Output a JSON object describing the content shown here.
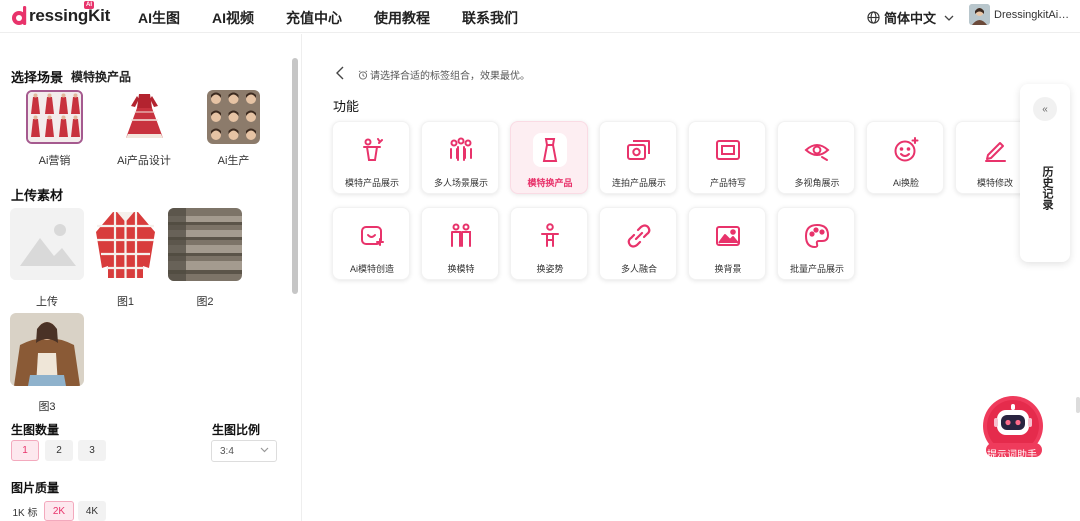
{
  "header": {
    "logo_text": "ressingKit",
    "logo_badge": "AI",
    "nav": [
      "AI生图",
      "AI视频",
      "充值中心",
      "使用教程",
      "联系我们"
    ],
    "language": "简体中文",
    "username": "DressingkitAi…"
  },
  "sidebar": {
    "scene_title": "选择场景",
    "scene_current": "模特换产品",
    "scenes": [
      {
        "label": "Ai营销",
        "icon": "red-dress-grid-image"
      },
      {
        "label": "Ai产品设计",
        "icon": "red-dress-image"
      },
      {
        "label": "Ai生产",
        "icon": "faces-grid-image"
      }
    ],
    "upload_title": "上传素材",
    "uploads": [
      {
        "label": "上传",
        "icon": "image-placeholder-icon"
      },
      {
        "label": "图1",
        "icon": "plaid-shirt-image"
      },
      {
        "label": "图2",
        "icon": "stone-steps-image"
      },
      {
        "label": "图3",
        "icon": "model-brown-jacket-image"
      }
    ],
    "count_title": "生图数量",
    "count_options": [
      "1",
      "2",
      "3"
    ],
    "count_selected": "1",
    "ratio_title": "生图比例",
    "ratio_value": "3:4",
    "quality_title": "图片质量",
    "quality_options": [
      "1K 标",
      "2K",
      "4K"
    ]
  },
  "main": {
    "hint": "请选择合适的标签组合，效果最优。",
    "section_title": "功能",
    "features": [
      {
        "label": "模特产品展示",
        "icon": "model-display-icon"
      },
      {
        "label": "多人场景展示",
        "icon": "group-scene-icon"
      },
      {
        "label": "模特换产品",
        "icon": "dress-swap-icon",
        "active": true
      },
      {
        "label": "连拍产品展示",
        "icon": "burst-photo-icon"
      },
      {
        "label": "产品特写",
        "icon": "closeup-frame-icon"
      },
      {
        "label": "多视角展示",
        "icon": "multi-view-eye-icon"
      },
      {
        "label": "Ai换脸",
        "icon": "face-swap-icon"
      },
      {
        "label": "模特修改",
        "icon": "edit-pen-icon"
      },
      {
        "label": "Ai模特创造",
        "icon": "ai-model-create-icon"
      },
      {
        "label": "换模特",
        "icon": "swap-model-icon"
      },
      {
        "label": "换姿势",
        "icon": "pose-icon"
      },
      {
        "label": "多人融合",
        "icon": "fusion-link-icon"
      },
      {
        "label": "换背景",
        "icon": "background-image-icon"
      },
      {
        "label": "批量产品展示",
        "icon": "palette-icon"
      }
    ]
  },
  "history": {
    "collapse": "«",
    "label": "历史记录"
  },
  "assistant": {
    "label": "提示词助手"
  },
  "colors": {
    "accent": "#e8336b",
    "accent_light": "#fdeef2"
  }
}
